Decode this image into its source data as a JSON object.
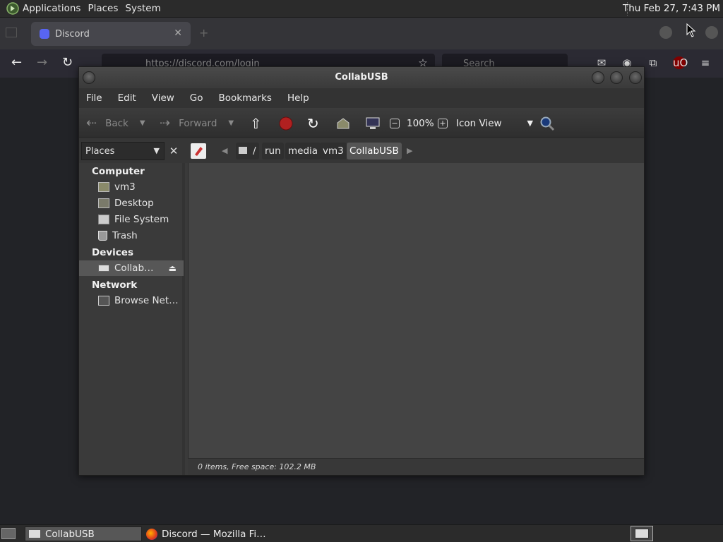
{
  "top_panel": {
    "menus": [
      "Applications",
      "Places",
      "System"
    ],
    "clock": "Thu Feb 27,  7:43 PM"
  },
  "firefox": {
    "tab_title": "Discord",
    "url": "https://discord.com/login",
    "search_placeholder": "Search"
  },
  "file_manager": {
    "title": "CollabUSB",
    "menu": [
      "File",
      "Edit",
      "View",
      "Go",
      "Bookmarks",
      "Help"
    ],
    "toolbar": {
      "back": "Back",
      "forward": "Forward",
      "zoom": "100%",
      "view_mode": "Icon View"
    },
    "sidebar_selector": "Places",
    "path": [
      "/",
      "run",
      "media",
      "vm3",
      "CollabUSB"
    ],
    "sidebar": {
      "computer_heading": "Computer",
      "computer_items": [
        "vm3",
        "Desktop",
        "File System",
        "Trash"
      ],
      "devices_heading": "Devices",
      "devices_items": [
        "Collab…"
      ],
      "network_heading": "Network",
      "network_items": [
        "Browse Net…"
      ]
    },
    "status": "0 items, Free space: 102.2 MB"
  },
  "taskbar": {
    "tasks": [
      "CollabUSB",
      "Discord — Mozilla Fi…"
    ]
  }
}
